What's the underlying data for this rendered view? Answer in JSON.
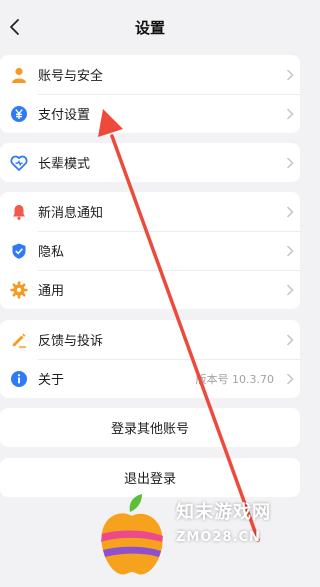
{
  "header": {
    "title": "设置"
  },
  "groups": [
    {
      "items": [
        {
          "icon": "user-icon",
          "label": "账号与安全",
          "value": ""
        },
        {
          "icon": "yuan-icon",
          "label": "支付设置",
          "value": ""
        }
      ]
    },
    {
      "items": [
        {
          "icon": "heart-icon",
          "label": "长辈模式",
          "value": ""
        }
      ]
    },
    {
      "items": [
        {
          "icon": "bell-icon",
          "label": "新消息通知",
          "value": ""
        },
        {
          "icon": "shield-check-icon",
          "label": "隐私",
          "value": ""
        },
        {
          "icon": "gear-icon",
          "label": "通用",
          "value": ""
        }
      ]
    },
    {
      "items": [
        {
          "icon": "pencil-icon",
          "label": "反馈与投诉",
          "value": ""
        },
        {
          "icon": "info-icon",
          "label": "关于",
          "value": "版本号 10.3.70"
        }
      ]
    }
  ],
  "buttons": {
    "switch_account": "登录其他账号",
    "logout": "退出登录"
  },
  "watermark": {
    "name": "知末游戏网",
    "url": "ZMO28.CN"
  },
  "colors": {
    "background": "#f2f2f4",
    "accent_blue": "#2f7bf5",
    "icon_orange": "#f59a23",
    "icon_red": "#f2594b",
    "annotation_arrow": "#ee4a3b"
  }
}
